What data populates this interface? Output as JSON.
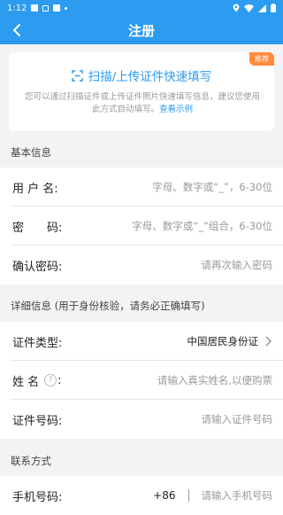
{
  "status_bar": {
    "time": "1:12"
  },
  "header": {
    "title": "注册"
  },
  "quick_fill": {
    "badge": "推荐",
    "title": "扫描/上传证件快速填写",
    "description": "您可以通过扫描证件或上传证件照片快速填写信息，建议您使用此方式自动填写。",
    "link": "查看示例"
  },
  "basic_section": {
    "label": "基本信息",
    "username": {
      "label": "用 户 名:",
      "placeholder": "字母、数字或“_”，6-30位"
    },
    "password": {
      "label": "密　　码:",
      "placeholder": "字母、数字或“_”组合，6-30位"
    },
    "confirm": {
      "label": "确认密码:",
      "placeholder": "请再次输入密码"
    }
  },
  "detail_section": {
    "label": "详细信息 (用于身份核验，请务必正确填写)",
    "id_type": {
      "label": "证件类型:",
      "value": "中国居民身份证"
    },
    "name": {
      "label_prefix": "姓 名",
      "help": "?",
      "label_suffix": ":",
      "placeholder": "请输入真实姓名,以便购票"
    },
    "id_number": {
      "label": "证件号码:",
      "placeholder": "请输入证件号码"
    }
  },
  "contact_section": {
    "label": "联系方式",
    "phone": {
      "label": "手机号码:",
      "prefix": "+86",
      "placeholder": "请输入手机号码"
    }
  }
}
